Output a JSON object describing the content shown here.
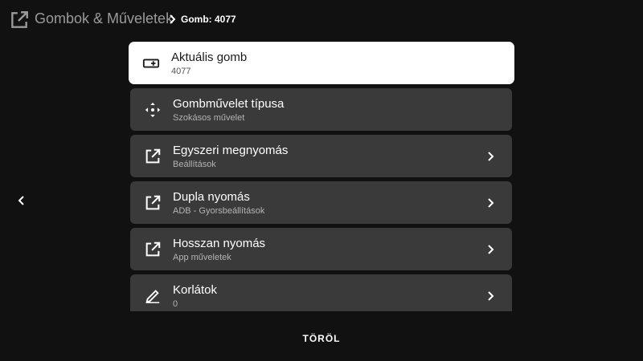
{
  "header": {
    "title": "Gombok & Műveletek",
    "breadcrumb": "Gomb: 4077",
    "icon": "open-external-icon",
    "separator_icon": "chevron-right-icon"
  },
  "nav": {
    "back_icon": "chevron-left-icon"
  },
  "items": [
    {
      "title": "Aktuális gomb",
      "subtitle": "4077",
      "icon": "remote-key-icon",
      "focused": true,
      "has_chevron": false
    },
    {
      "title": "Gombművelet típusa",
      "subtitle": "Szokásos művelet",
      "icon": "move-arrows-icon",
      "focused": false,
      "has_chevron": false
    },
    {
      "title": "Egyszeri megnyomás",
      "subtitle": "Beállítások",
      "icon": "open-external-icon",
      "focused": false,
      "has_chevron": true
    },
    {
      "title": "Dupla nyomás",
      "subtitle": "ADB - Gyorsbeállítások",
      "icon": "open-external-icon",
      "focused": false,
      "has_chevron": true
    },
    {
      "title": "Hosszan nyomás",
      "subtitle": "App műveletek",
      "icon": "open-external-icon",
      "focused": false,
      "has_chevron": true
    },
    {
      "title": "Korlátok",
      "subtitle": "0",
      "icon": "pencil-icon",
      "focused": false,
      "has_chevron": true
    }
  ],
  "footer": {
    "delete_label": "TÖRÖL"
  },
  "colors": {
    "background": "#111111",
    "item": "#3a3a3a",
    "item_focused": "#ffffff"
  }
}
